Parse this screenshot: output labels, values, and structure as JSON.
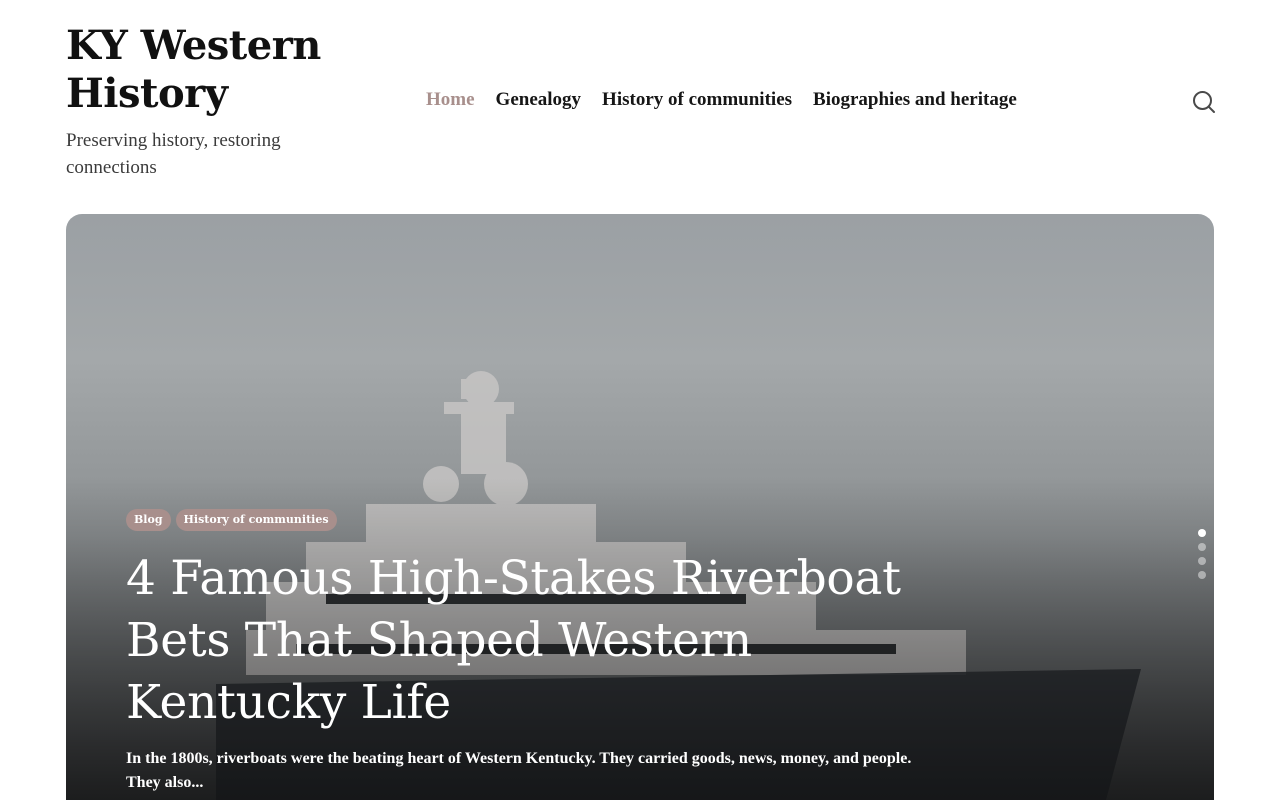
{
  "site": {
    "title": "KY Western History",
    "tagline": "Preserving history, restoring connections"
  },
  "nav": {
    "items": [
      {
        "label": "Home",
        "active": true
      },
      {
        "label": "Genealogy"
      },
      {
        "label": "History of communities"
      },
      {
        "label": "Biographies and heritage"
      }
    ]
  },
  "search": {
    "icon": "search-icon"
  },
  "hero": {
    "categories": [
      "Blog",
      "History of communities"
    ],
    "title": "4 Famous High-Stakes Riverboat Bets That Shaped Western Kentucky Life",
    "excerpt": "In the 1800s, riverboats were the beating heart of Western Kentucky. They carried goods, news, money, and people. They also...",
    "slide_count": 4,
    "active_slide": 1
  },
  "colors": {
    "accent": "#a88f8c",
    "text": "#111111",
    "tagline": "#3b3b3b"
  }
}
